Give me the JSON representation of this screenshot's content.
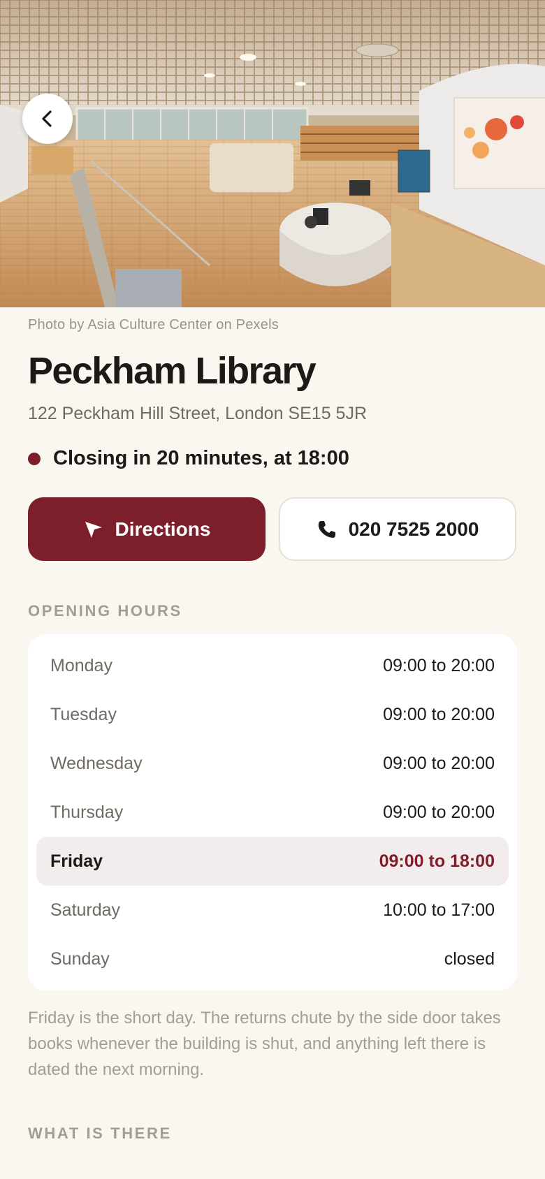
{
  "hero": {
    "photo_credit": "Photo by Asia Culture Center on Pexels",
    "back_icon": "chevron-left-icon"
  },
  "library": {
    "name": "Peckham Library",
    "address": "122 Peckham Hill Street, London SE15 5JR",
    "status": "Closing in 20 minutes, at 18:00"
  },
  "actions": {
    "directions_label": "Directions",
    "directions_icon": "navigation-arrow-icon",
    "phone_label": "020 7525 2000",
    "phone_icon": "phone-icon"
  },
  "opening_hours": {
    "heading": "OPENING HOURS",
    "rows": [
      {
        "day": "Monday",
        "time": "09:00 to 20:00",
        "today": false
      },
      {
        "day": "Tuesday",
        "time": "09:00 to 20:00",
        "today": false
      },
      {
        "day": "Wednesday",
        "time": "09:00 to 20:00",
        "today": false
      },
      {
        "day": "Thursday",
        "time": "09:00 to 20:00",
        "today": false
      },
      {
        "day": "Friday",
        "time": "09:00 to 18:00",
        "today": true
      },
      {
        "day": "Saturday",
        "time": "10:00 to 17:00",
        "today": false
      },
      {
        "day": "Sunday",
        "time": "closed",
        "today": false
      }
    ],
    "note": "Friday is the short day. The returns chute by the side door takes books whenever the building is shut, and anything left there is dated the next morning."
  },
  "what_is_there": {
    "heading": "WHAT IS THERE"
  },
  "colors": {
    "accent": "#7d1f2b",
    "background": "#faf7f0",
    "muted_text": "#a39d93"
  }
}
